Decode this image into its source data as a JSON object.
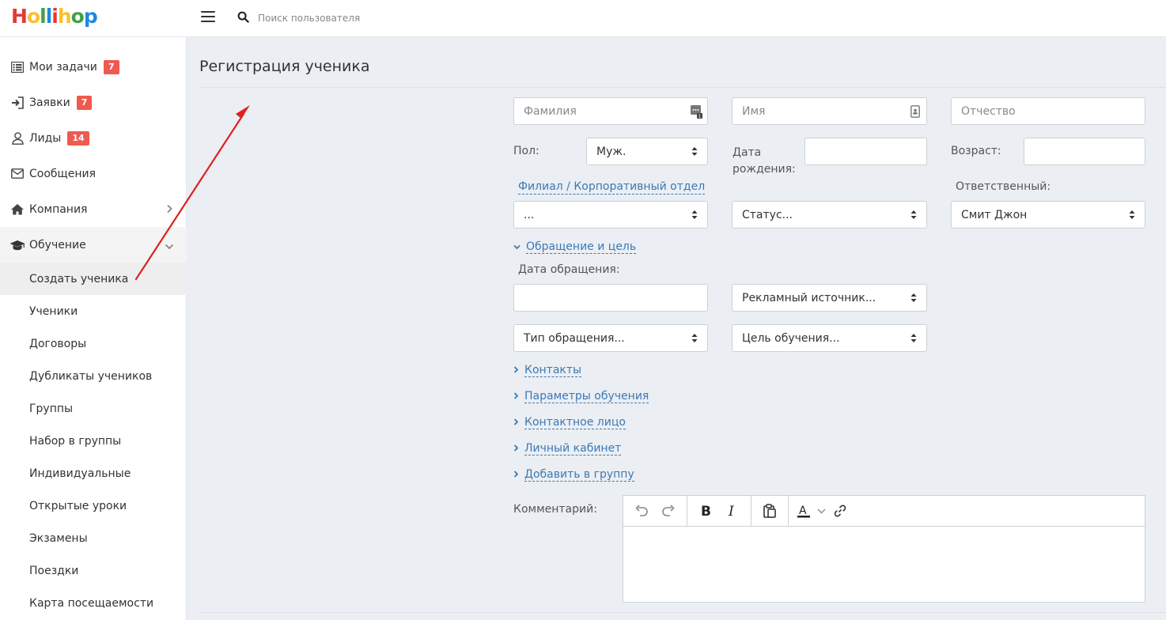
{
  "logo": {
    "letters": [
      "H",
      "o",
      "l",
      "l",
      "i",
      "h",
      "o",
      "p"
    ],
    "colors": [
      "#e53935",
      "#fbc02d",
      "#43a047",
      "#1e88e5",
      "#e53935",
      "#fbc02d",
      "#43a047",
      "#1e88e5"
    ]
  },
  "header": {
    "search_placeholder": "Поиск пользователя"
  },
  "sidebar": {
    "items": [
      {
        "label": "Мои задачи",
        "badge": "7"
      },
      {
        "label": "Заявки",
        "badge": "7"
      },
      {
        "label": "Лиды",
        "badge": "14"
      },
      {
        "label": "Сообщения"
      },
      {
        "label": "Компания"
      },
      {
        "label": "Обучение"
      }
    ],
    "sub_items": [
      "Создать ученика",
      "Ученики",
      "Договоры",
      "Дубликаты учеников",
      "Группы",
      "Набор в группы",
      "Индивидуальные",
      "Открытые уроки",
      "Экзамены",
      "Поездки",
      "Карта посещаемости"
    ]
  },
  "page": {
    "title": "Регистрация ученика"
  },
  "form": {
    "lastname_placeholder": "Фамилия",
    "firstname_placeholder": "Имя",
    "middlename_placeholder": "Отчество",
    "gender_label": "Пол:",
    "gender_value": "Муж.",
    "birthdate_label_1": "Дата",
    "birthdate_label_2": "рождения:",
    "age_label": "Возраст:",
    "branch_link": "Филиал / Корпоративный отдел",
    "branch_value": "...",
    "status_value": "Статус...",
    "responsible_label": "Ответственный:",
    "responsible_value": "Смит Джон",
    "section_appeal": "Обращение и цель",
    "appeal_date_label": "Дата обращения:",
    "ad_source_value": "Рекламный источник...",
    "appeal_type_value": "Тип обращения...",
    "study_goal_value": "Цель обучения...",
    "sections": [
      "Контакты",
      "Параметры обучения",
      "Контактное лицо",
      "Личный кабинет",
      "Добавить в группу"
    ],
    "comment_label": "Комментарий:"
  },
  "annotation": {
    "arrow_color": "#e02020"
  }
}
